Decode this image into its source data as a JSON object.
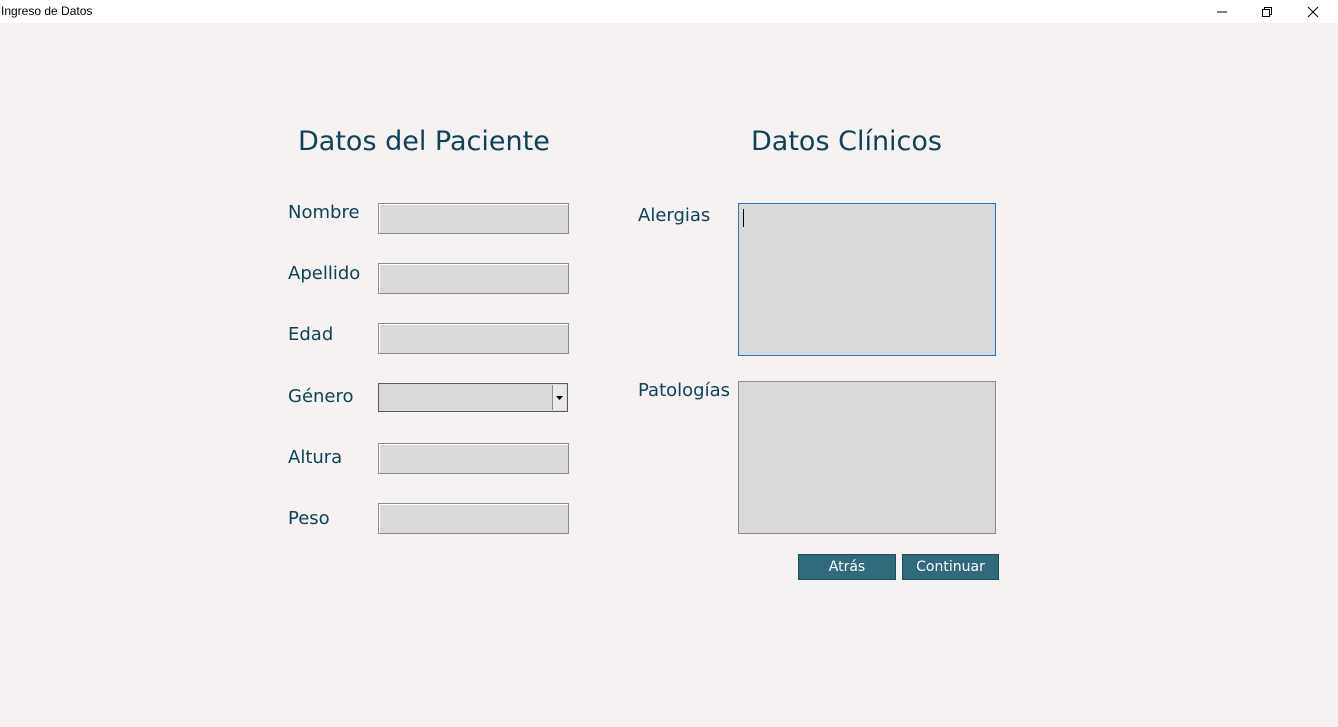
{
  "window": {
    "title": "Ingreso de Datos",
    "minimize_icon": "minimize-icon",
    "restore_icon": "restore-icon",
    "close_icon": "close-icon"
  },
  "patient": {
    "heading": "Datos del Paciente",
    "fields": {
      "nombre": {
        "label": "Nombre",
        "value": ""
      },
      "apellido": {
        "label": "Apellido",
        "value": ""
      },
      "edad": {
        "label": "Edad",
        "value": ""
      },
      "genero": {
        "label": "Género",
        "value": ""
      },
      "altura": {
        "label": "Altura",
        "value": ""
      },
      "peso": {
        "label": "Peso",
        "value": ""
      }
    }
  },
  "clinical": {
    "heading": "Datos Clínicos",
    "alergias": {
      "label": "Alergias",
      "value": ""
    },
    "patologias": {
      "label": "Patologías",
      "value": ""
    }
  },
  "actions": {
    "back_label": "Atrás",
    "continue_label": "Continuar"
  },
  "colors": {
    "background": "#f6f2f1",
    "text_accent": "#0f4257",
    "field_bg": "#d9d9d9",
    "button_bg": "#2f6b7a"
  }
}
